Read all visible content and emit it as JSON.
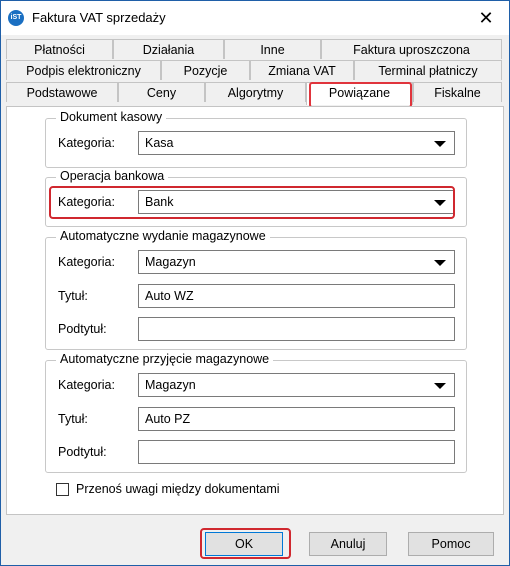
{
  "window": {
    "title": "Faktura VAT sprzedaży",
    "app_icon_text": "iST",
    "close_glyph": "✕"
  },
  "tabs": {
    "row1": [
      "Płatności",
      "Działania",
      "Inne",
      "Faktura uproszczona"
    ],
    "row2": [
      "Podpis elektroniczny",
      "Pozycje",
      "Zmiana VAT",
      "Terminal płatniczy"
    ],
    "row3": [
      "Podstawowe",
      "Ceny",
      "Algorytmy",
      "Powiązane",
      "Fiskalne"
    ],
    "active": "Powiązane"
  },
  "dokument_kasowy": {
    "title": "Dokument kasowy",
    "kategoria_label": "Kategoria:",
    "kategoria_value": "Kasa"
  },
  "operacja_bankowa": {
    "title": "Operacja bankowa",
    "kategoria_label": "Kategoria:",
    "kategoria_value": "Bank"
  },
  "wydanie": {
    "title": "Automatyczne wydanie magazynowe",
    "kategoria_label": "Kategoria:",
    "kategoria_value": "Magazyn",
    "tytul_label": "Tytuł:",
    "tytul_value": "Auto WZ",
    "podtytul_label": "Podtytuł:",
    "podtytul_value": ""
  },
  "przyjecie": {
    "title": "Automatyczne przyjęcie magazynowe",
    "kategoria_label": "Kategoria:",
    "kategoria_value": "Magazyn",
    "tytul_label": "Tytuł:",
    "tytul_value": "Auto PZ",
    "podtytul_label": "Podtytuł:",
    "podtytul_value": ""
  },
  "checkbox": {
    "label": "Przenoś uwagi między dokumentami",
    "checked": false
  },
  "buttons": {
    "ok": "OK",
    "cancel": "Anuluj",
    "help": "Pomoc"
  },
  "colors": {
    "highlight": "#d0282f",
    "accent": "#0078d7"
  }
}
